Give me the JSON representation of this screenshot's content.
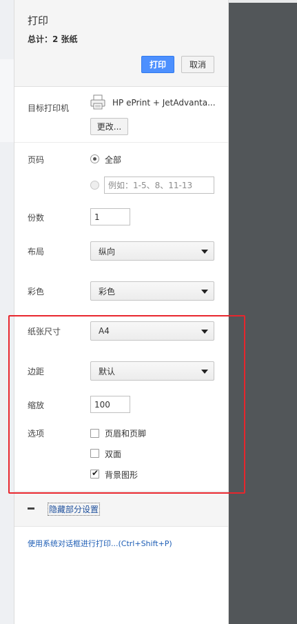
{
  "header": {
    "title": "打印",
    "total": "总计：2 张纸",
    "print_label": "打印",
    "cancel_label": "取消"
  },
  "destination": {
    "label": "目标打印机",
    "printer_name": "HP ePrint + JetAdvanta...",
    "change_label": "更改..."
  },
  "pages": {
    "label": "页码",
    "all_label": "全部",
    "range_placeholder": "例如：1-5、8、11-13"
  },
  "copies": {
    "label": "份数",
    "value": "1"
  },
  "layout": {
    "label": "布局",
    "value": "纵向"
  },
  "color": {
    "label": "彩色",
    "value": "彩色"
  },
  "paper_size": {
    "label": "纸张尺寸",
    "value": "A4"
  },
  "margins": {
    "label": "边距",
    "value": "默认"
  },
  "scale": {
    "label": "缩放",
    "value": "100"
  },
  "options": {
    "label": "选项",
    "items": [
      {
        "label": "页眉和页脚",
        "checked": false
      },
      {
        "label": "双面",
        "checked": false
      },
      {
        "label": "背景图形",
        "checked": true
      }
    ]
  },
  "more_settings": {
    "label": "隐藏部分设置"
  },
  "system_dialog": {
    "label": "使用系统对话框进行打印...(Ctrl+Shift+P)"
  },
  "colors": {
    "accent": "#4d90fe",
    "highlight_box": "#e8262d",
    "preview_bg": "#525659"
  }
}
